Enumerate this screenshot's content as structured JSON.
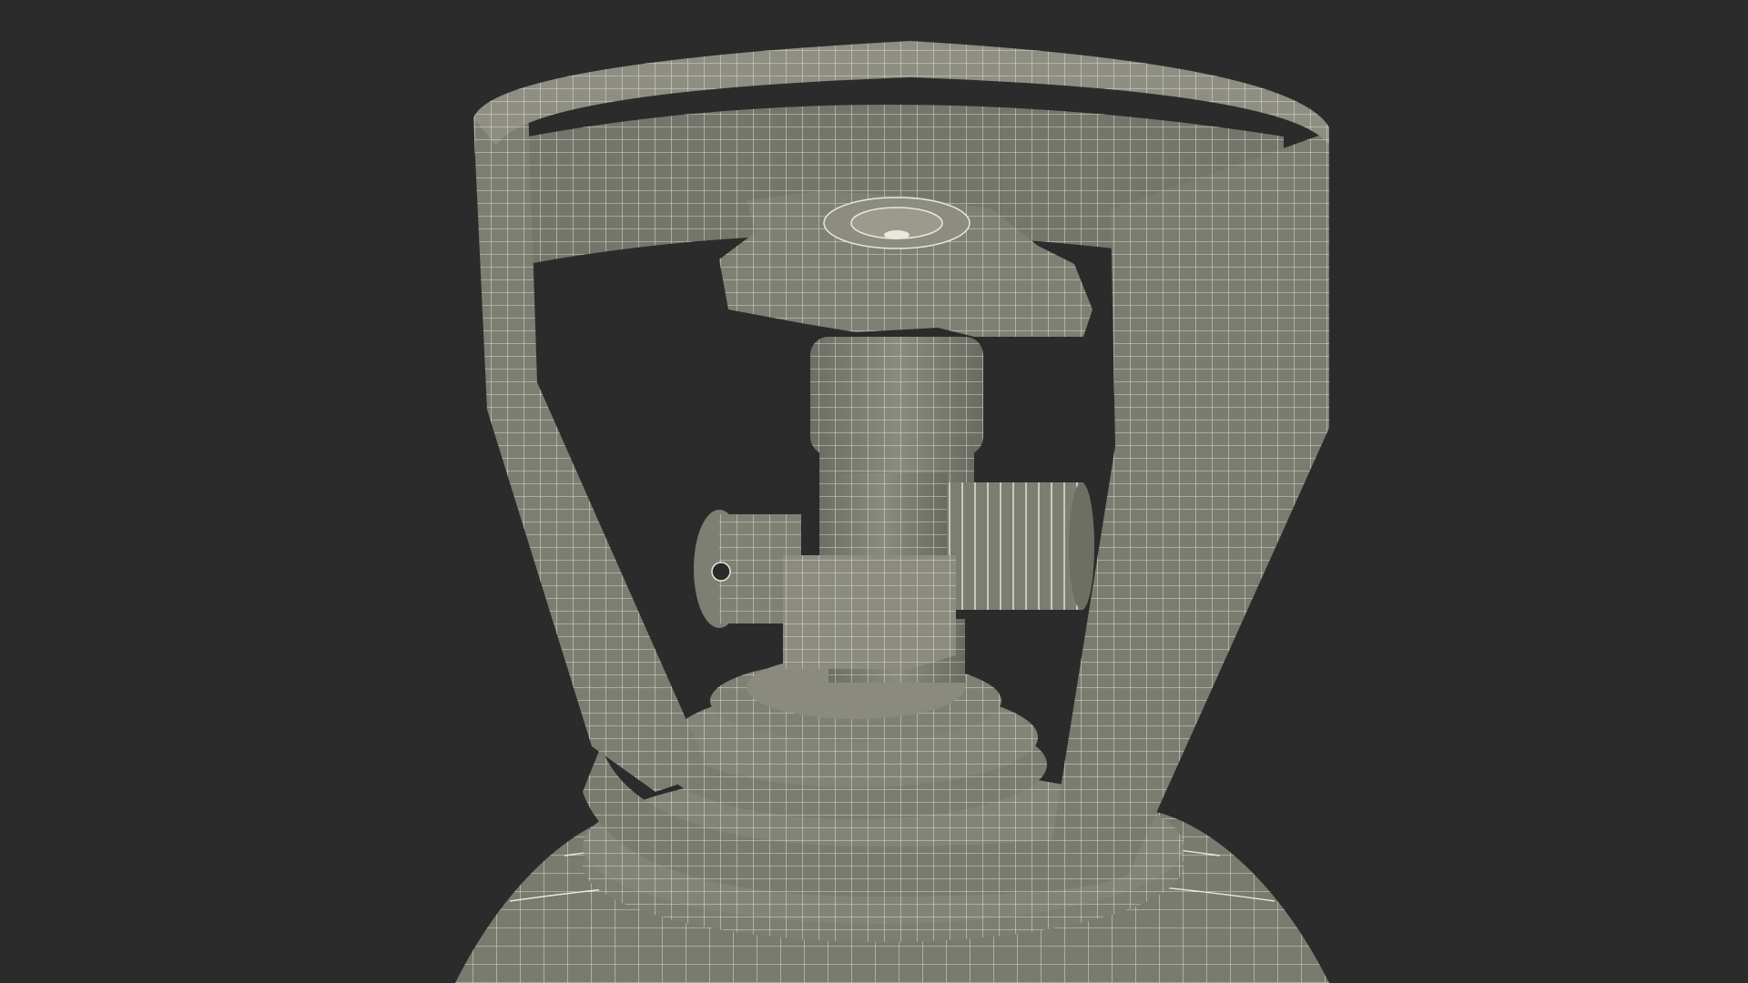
{
  "scene": {
    "subject": "gas-cylinder-valve-wireframe",
    "colors": {
      "background": "#2b2b2b",
      "surface": "#7d7e72",
      "surface_light": "#8f9083",
      "surface_dark": "#5f6057",
      "wire": "#e9e8dc",
      "hole": "#2b2b2b"
    }
  }
}
